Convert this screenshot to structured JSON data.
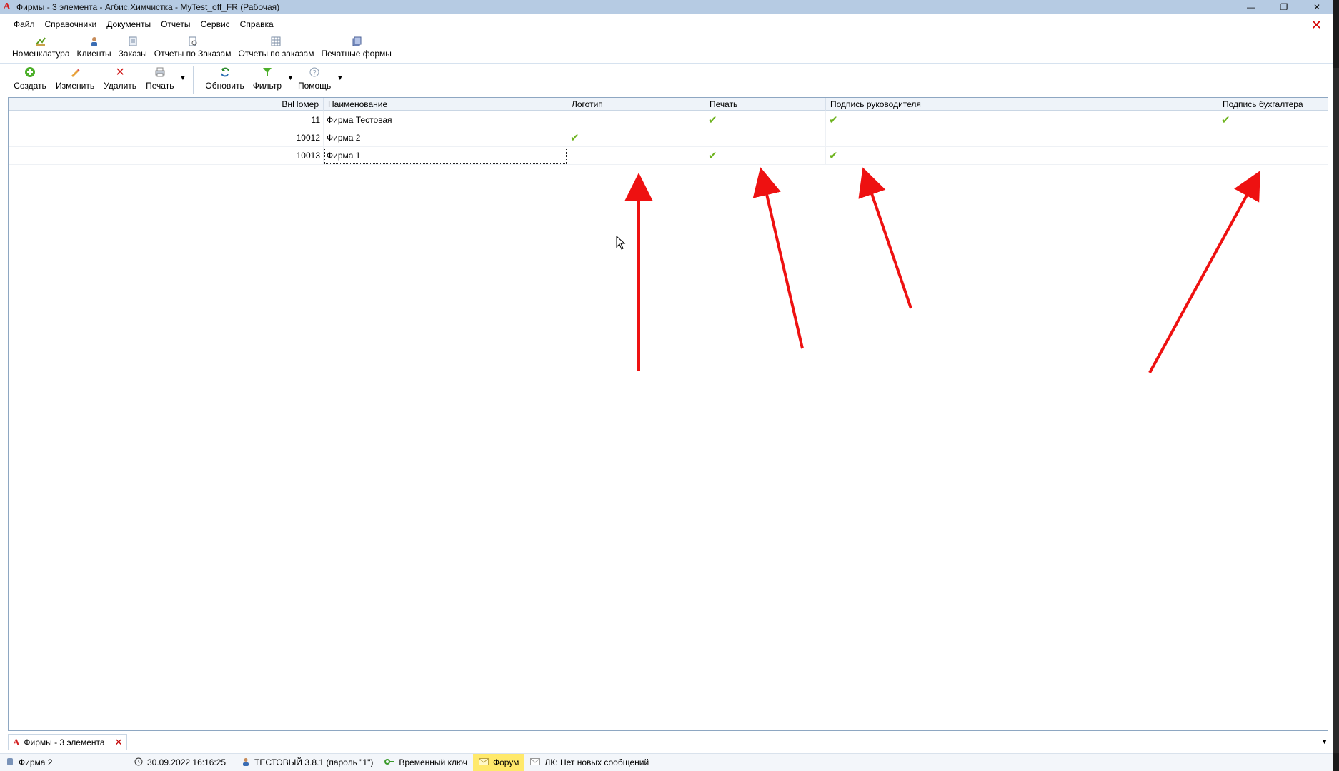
{
  "window": {
    "title": "Фирмы - 3 элемента - Агбис.Химчистка - MyTest_off_FR (Рабочая)",
    "logo_letter": "A",
    "controls": [
      "—",
      "❐",
      "✕"
    ]
  },
  "menubar": {
    "items": [
      "Файл",
      "Справочники",
      "Документы",
      "Отчеты",
      "Сервис",
      "Справка"
    ],
    "close_glyph": "✕"
  },
  "navbar": {
    "items": [
      {
        "label": "Номенклатура",
        "icon": "nomenclature-icon"
      },
      {
        "label": "Клиенты",
        "icon": "clients-icon"
      },
      {
        "label": "Заказы",
        "icon": "orders-icon"
      },
      {
        "label": "Отчеты по Заказам",
        "icon": "order-reports-icon"
      },
      {
        "label": "Отчеты по заказам",
        "icon": "order-reports-grid-icon"
      },
      {
        "label": "Печатные формы",
        "icon": "print-forms-icon"
      }
    ]
  },
  "actions": {
    "create": "Создать",
    "edit": "Изменить",
    "delete": "Удалить",
    "print": "Печать",
    "refresh": "Обновить",
    "filter": "Фильтр",
    "help": "Помощь",
    "dropdown_glyph": "▼"
  },
  "grid": {
    "columns": [
      "ВнНомер",
      "Наименование",
      "Логотип",
      "Печать",
      "Подпись руководителя",
      "Подпись бухгалтера"
    ],
    "check_glyph": "✔",
    "rows": [
      {
        "id": "11",
        "name": "Фирма Тестовая",
        "logo": false,
        "stamp": true,
        "director_sign": true,
        "accountant_sign": true
      },
      {
        "id": "10012",
        "name": "Фирма 2",
        "logo": true,
        "stamp": false,
        "director_sign": false,
        "accountant_sign": false
      },
      {
        "id": "10013",
        "name": "Фирма 1",
        "logo": false,
        "stamp": true,
        "director_sign": true,
        "accountant_sign": false
      }
    ]
  },
  "tabs": {
    "active": "Фирмы - 3 элемента",
    "close_glyph": "✕"
  },
  "statusbar": {
    "firm": "Фирма 2",
    "datetime": "30.09.2022 16:16:25",
    "user": "ТЕСТОВЫЙ 3.8.1 (пароль \"1\")",
    "key": "Временный ключ",
    "forum": "Форум",
    "messages": "ЛК: Нет новых сообщений"
  },
  "colors": {
    "titlebar": "#b6cbe3",
    "check": "#6db31e",
    "arrow": "#ee1111",
    "forum_highlight": "#ffe96b"
  }
}
